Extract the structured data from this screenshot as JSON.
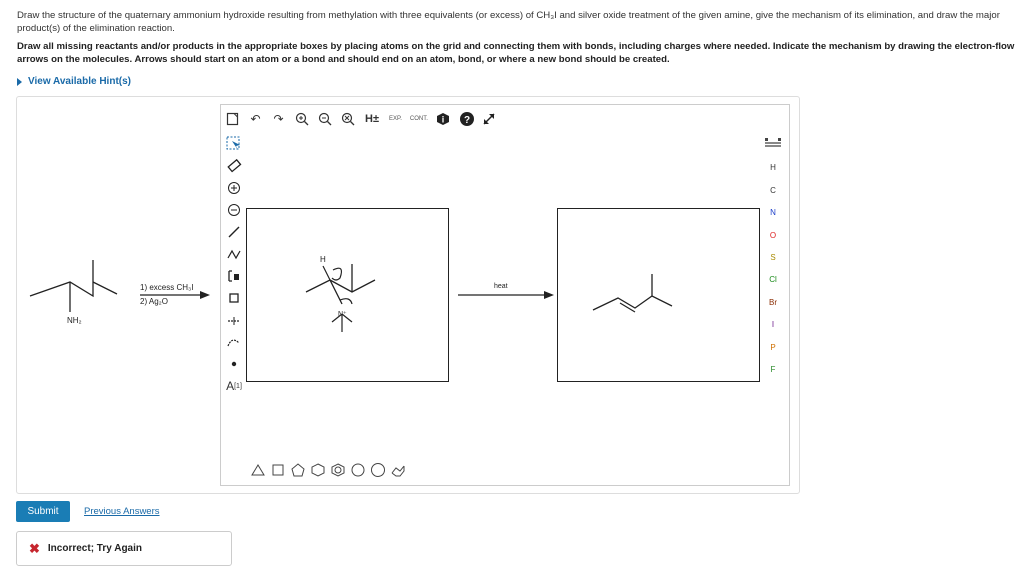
{
  "question": {
    "line1": "Draw the structure of the quaternary ammonium hydroxide resulting from methylation with three equivalents (or excess) of CH₃I and silver oxide treatment of the given amine, give the mechanism of its elimination, and draw the major product(s) of the elimination reaction.",
    "line2": "Draw all missing reactants and/or products in the appropriate boxes by placing atoms on the grid and connecting them with bonds, including charges where needed. Indicate the mechanism by drawing the electron-flow arrows on the molecules. Arrows should start on an atom or a bond and should end on an atom, bond, or where a new bond should be created."
  },
  "hint_label": "View Available Hint(s)",
  "toolbar": {
    "exp_label": "EXP.",
    "cont_label": "CONT."
  },
  "elements": [
    "H",
    "C",
    "N",
    "O",
    "S",
    "Cl",
    "Br",
    "I",
    "P",
    "F"
  ],
  "reaction": {
    "amine_label": "NH₂",
    "reagent1": "1) excess CH₃I",
    "reagent2": "2) Ag₂O",
    "heat_label": "heat",
    "h_label": "H",
    "n_label": "N⁺"
  },
  "atom_tool_label": "A",
  "atom_tool_sup": "[1]",
  "submit_label": "Submit",
  "previous_answers_label": "Previous Answers",
  "feedback_text": "Incorrect; Try Again"
}
